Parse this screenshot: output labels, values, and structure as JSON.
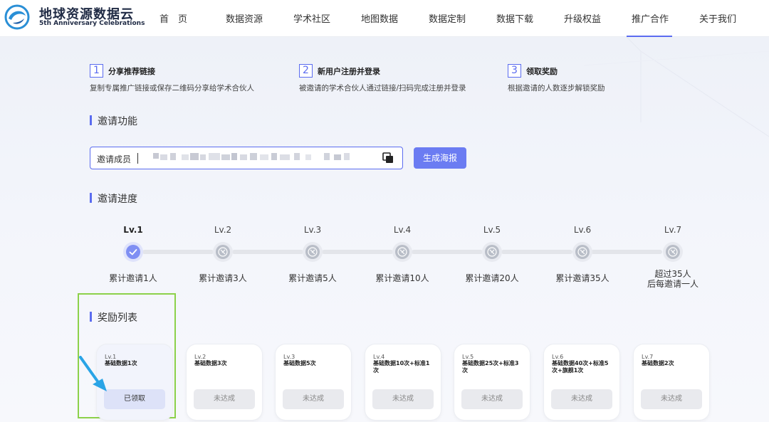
{
  "header": {
    "brand_name": "地球资源数据云",
    "brand_sub": "5th Anniversary Celebrations",
    "nav": [
      "首　页",
      "数据资源",
      "学术社区",
      "地图数据",
      "数据定制",
      "数据下载",
      "升级权益",
      "推广合作",
      "关于我们"
    ],
    "active_nav": "推广合作",
    "accent_color": "#5b6cf0"
  },
  "steps": [
    {
      "num": "1",
      "title": "分享推荐链接",
      "desc": "复制专属推广链接或保存二维码分享给学术合伙人"
    },
    {
      "num": "2",
      "title": "新用户注册并登录",
      "desc": "被邀请的学术合伙人通过链接/扫码完成注册并登录"
    },
    {
      "num": "3",
      "title": "领取奖励",
      "desc": "根据邀请的人数逐步解锁奖励"
    }
  ],
  "invite": {
    "section_title": "邀请功能",
    "label": "邀请成员",
    "copy_icon": "copy-icon",
    "generate_button": "生成海报"
  },
  "progress": {
    "section_title": "邀请进度",
    "levels": [
      {
        "label": "Lv.1",
        "requirement": "累计邀请1人",
        "done": true
      },
      {
        "label": "Lv.2",
        "requirement": "累计邀请3人",
        "done": false
      },
      {
        "label": "Lv.3",
        "requirement": "累计邀请5人",
        "done": false
      },
      {
        "label": "Lv.4",
        "requirement": "累计邀请10人",
        "done": false
      },
      {
        "label": "Lv.5",
        "requirement": "累计邀请20人",
        "done": false
      },
      {
        "label": "Lv.6",
        "requirement": "累计邀请35人",
        "done": false
      },
      {
        "label": "Lv.7",
        "requirement_line1": "超过35人",
        "requirement_line2": "后每邀请一人",
        "done": false
      }
    ]
  },
  "rewards": {
    "section_title": "奖励列表",
    "cards": [
      {
        "level": "Lv.1",
        "desc": "基础数据1次",
        "button": "已领取",
        "done": true
      },
      {
        "level": "Lv.2",
        "desc": "基础数据3次",
        "button": "未达成",
        "done": false
      },
      {
        "level": "Lv.3",
        "desc": "基础数据5次",
        "button": "未达成",
        "done": false
      },
      {
        "level": "Lv.4",
        "desc": "基础数据10次+标准1次",
        "button": "未达成",
        "done": false
      },
      {
        "level": "Lv.5",
        "desc": "基础数据25次+标准3次",
        "button": "未达成",
        "done": false
      },
      {
        "level": "Lv.6",
        "desc": "基础数据40次+标准5次+旗舰1次",
        "button": "未达成",
        "done": false
      },
      {
        "level": "Lv.7",
        "desc": "基础数据2次",
        "button": "未达成",
        "done": false
      }
    ]
  }
}
